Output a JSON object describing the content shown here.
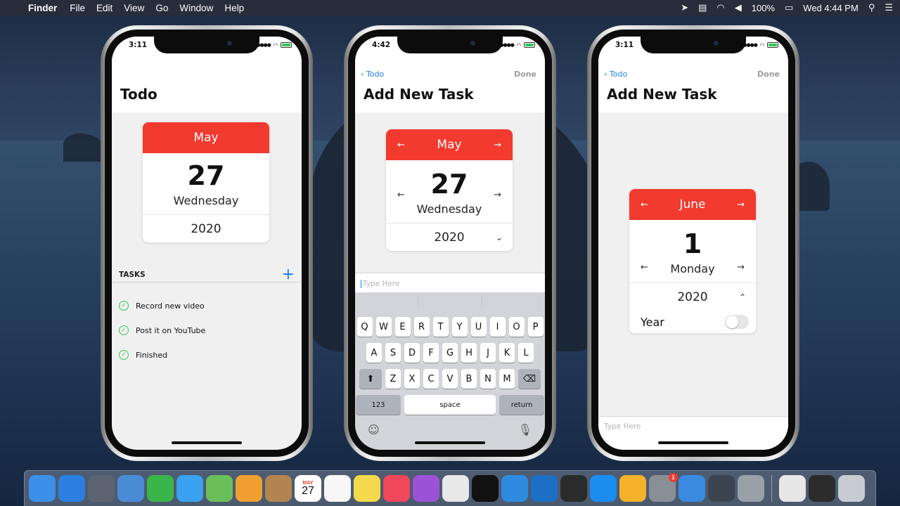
{
  "menubar": {
    "apple": "",
    "app": "Finder",
    "items": [
      "File",
      "Edit",
      "View",
      "Go",
      "Window",
      "Help"
    ],
    "battery": "100%",
    "clock": "Wed 4:44 PM"
  },
  "phone1": {
    "time": "3:11",
    "title": "Todo",
    "calendar": {
      "month": "May",
      "day": "27",
      "weekday": "Wednesday",
      "year": "2020"
    },
    "tasks_header": "TASKS",
    "add_glyph": "+",
    "tasks": [
      "Record new video",
      "Post it on YouTube",
      "Finished"
    ]
  },
  "phone2": {
    "time": "4:42",
    "back": "Todo",
    "done": "Done",
    "title": "Add New Task",
    "calendar": {
      "month": "May",
      "day": "27",
      "weekday": "Wednesday",
      "year": "2020"
    },
    "placeholder": "Type Here",
    "keyboard": {
      "row1": [
        "Q",
        "W",
        "E",
        "R",
        "T",
        "Y",
        "U",
        "I",
        "O",
        "P"
      ],
      "row2": [
        "A",
        "S",
        "D",
        "F",
        "G",
        "H",
        "J",
        "K",
        "L"
      ],
      "row3": [
        "Z",
        "X",
        "C",
        "V",
        "B",
        "N",
        "M"
      ],
      "numbers": "123",
      "space": "space",
      "return": "return"
    }
  },
  "phone3": {
    "time": "3:11",
    "back": "Todo",
    "done": "Done",
    "title": "Add New Task",
    "calendar": {
      "month": "June",
      "day": "1",
      "weekday": "Monday",
      "year": "2020"
    },
    "year_label": "Year",
    "year_toggle_on": false,
    "placeholder": "Type Here"
  },
  "dock": {
    "calendar_month": "MAY",
    "calendar_day": "27",
    "settings_badge": "1",
    "apps": [
      {
        "name": "finder-icon",
        "color": "#3b8fe6"
      },
      {
        "name": "safari-icon",
        "color": "#2a7fe0"
      },
      {
        "name": "launchpad-icon",
        "color": "#5b6470"
      },
      {
        "name": "mail-icon",
        "color": "#4a8bd6"
      },
      {
        "name": "facetime-icon",
        "color": "#39b54a"
      },
      {
        "name": "messages-icon",
        "color": "#3aa2f0"
      },
      {
        "name": "maps-icon",
        "color": "#6bbf5a"
      },
      {
        "name": "photos-icon",
        "color": "#f0a030"
      },
      {
        "name": "contacts-icon",
        "color": "#b48450"
      },
      {
        "name": "calendar-icon",
        "color": "#ffffff"
      },
      {
        "name": "reminders-icon",
        "color": "#f7f7f7"
      },
      {
        "name": "notes-icon",
        "color": "#f5d94c"
      },
      {
        "name": "music-icon",
        "color": "#f0485a"
      },
      {
        "name": "podcasts-icon",
        "color": "#9b52d6"
      },
      {
        "name": "chrome-icon",
        "color": "#e8e8e8"
      },
      {
        "name": "apple-tv-icon",
        "color": "#111111"
      },
      {
        "name": "xcode-icon",
        "color": "#2e8ae0"
      },
      {
        "name": "vscode-icon",
        "color": "#1b6fc4"
      },
      {
        "name": "final-cut-icon",
        "color": "#2b2b2b"
      },
      {
        "name": "app-store-icon",
        "color": "#1b8cf0"
      },
      {
        "name": "sketch-icon",
        "color": "#f5b22a"
      },
      {
        "name": "system-preferences-icon",
        "color": "#8a8f96"
      },
      {
        "name": "screen-share-icon",
        "color": "#3a8ae0"
      },
      {
        "name": "hex-app-icon",
        "color": "#3c4450"
      },
      {
        "name": "disk-utility-icon",
        "color": "#9aa0a8"
      }
    ],
    "stacks": [
      {
        "name": "printer-stack-icon",
        "color": "#e6e6e6"
      },
      {
        "name": "downloads-stack-icon",
        "color": "#2b2b2b"
      },
      {
        "name": "trash-icon",
        "color": "#c8ccd2"
      }
    ]
  }
}
